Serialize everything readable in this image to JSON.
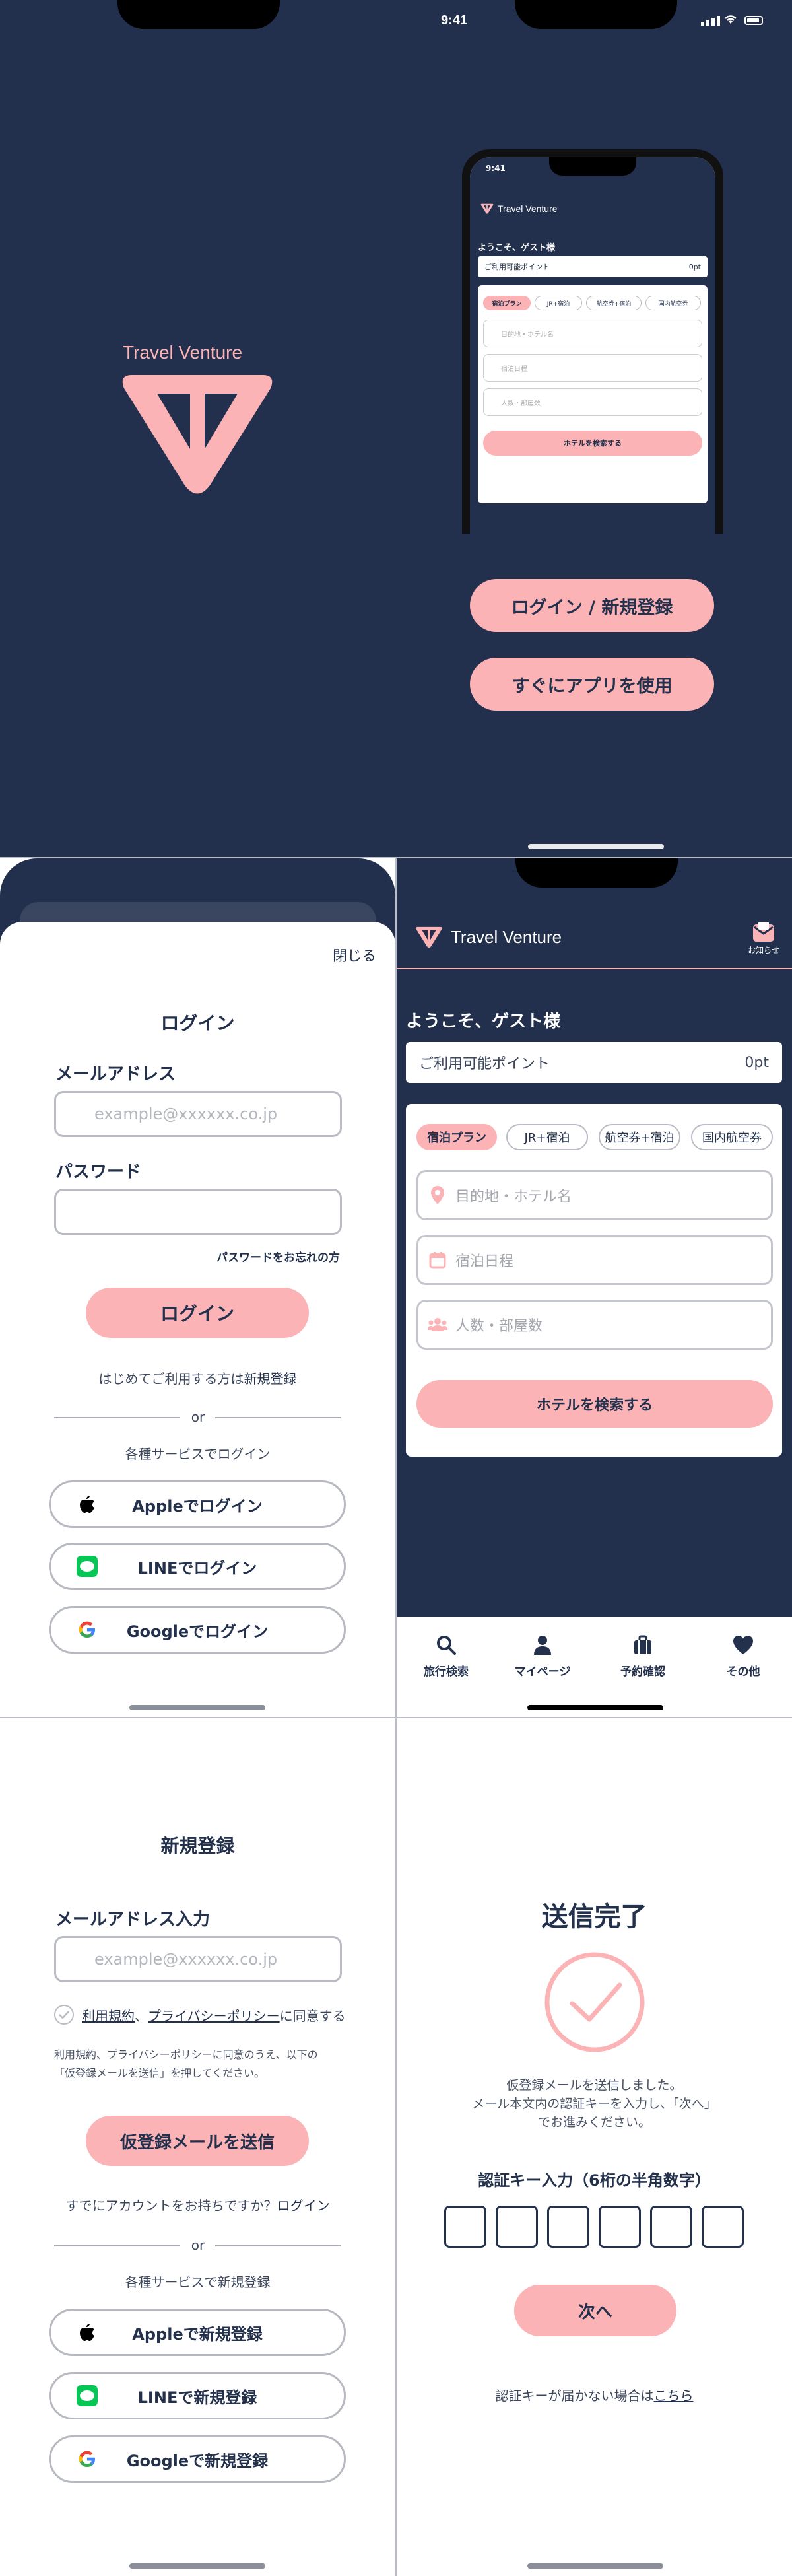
{
  "status_bar": {
    "time": "9:41"
  },
  "brand": {
    "name": "Travel Venture",
    "notice_label": "お知らせ"
  },
  "splash": {
    "login_register_button": "ログイン / 新規登録",
    "use_app_button": "すぐにアプリを使用"
  },
  "home": {
    "welcome": "ようこそ、ゲスト様",
    "points_label": "ご利用可能ポイント",
    "points_value": "0pt",
    "tabs": [
      "宿泊プラン",
      "JR+宿泊",
      "航空券+宿泊",
      "国内航空券"
    ],
    "destination_placeholder": "目的地・ホテル名",
    "dates_placeholder": "宿泊日程",
    "guests_placeholder": "人数・部屋数",
    "search_button": "ホテルを検索する",
    "bottom_nav": [
      "旅行検索",
      "マイページ",
      "予約確認",
      "その他"
    ]
  },
  "login": {
    "close": "閉じる",
    "title": "ログイン",
    "email_label": "メールアドレス",
    "email_placeholder": "example@xxxxxx.co.jp",
    "password_label": "パスワード",
    "forgot_password": "パスワードをお忘れの方",
    "login_button": "ログイン",
    "first_time_prefix": "はじめてご利用する方は",
    "first_time_link": "新規登録",
    "or": "or",
    "social_caption": "各種サービスでログイン",
    "apple": "Appleでログイン",
    "line": "LINEでログイン",
    "google": "Googleでログイン"
  },
  "register": {
    "title": "新規登録",
    "email_label": "メールアドレス入力",
    "email_placeholder": "example@xxxxxx.co.jp",
    "terms_link": "利用規約",
    "terms_sep": "、",
    "privacy_link": "プライバシーポリシー",
    "agree_suffix": "に同意する",
    "note_line1": "利用規約、プライバシーポリシーに同意のうえ、以下の",
    "note_line2": "「仮登録メールを送信」を押してください。",
    "send_button": "仮登録メールを送信",
    "have_account_prefix": "すでにアカウントをお持ちですか？",
    "have_account_link": "ログイン",
    "or": "or",
    "social_caption": "各種サービスで新規登録",
    "apple": "Appleで新規登録",
    "line": "LINEで新規登録",
    "google": "Googleで新規登録"
  },
  "verify": {
    "title": "送信完了",
    "message_line1": "仮登録メールを送信しました。",
    "message_line2": "メール本文内の認証キーを入力し、「次へ」",
    "message_line3": "でお進みください。",
    "code_label": "認証キー入力（6桁の半角数字）",
    "next_button": "次へ",
    "resend_prefix": "認証キーが届かない場合は",
    "resend_link": "こちら"
  },
  "colors": {
    "navy": "#22304d",
    "pink": "#fbb3b6",
    "line_green": "#06c755"
  }
}
